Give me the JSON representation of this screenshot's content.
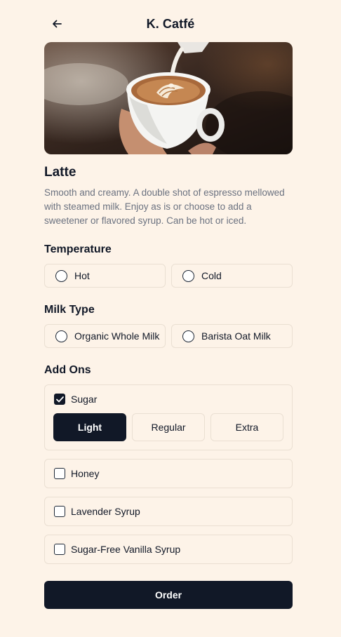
{
  "header": {
    "title": "K. Catfé",
    "back_icon": "arrow-left-icon"
  },
  "product": {
    "name": "Latte",
    "description": "Smooth and creamy. A double shot of espresso mellowed with steamed milk. Enjoy as is or choose to add a sweetener or flavored syrup. Can be hot or iced."
  },
  "temperature": {
    "title": "Temperature",
    "options": [
      "Hot",
      "Cold"
    ],
    "selected": null
  },
  "milk": {
    "title": "Milk Type",
    "options": [
      "Organic Whole Milk",
      "Barista Oat Milk"
    ],
    "selected": null
  },
  "addons": {
    "title": "Add Ons",
    "items": [
      {
        "label": "Sugar",
        "checked": true,
        "levels": [
          "Light",
          "Regular",
          "Extra"
        ],
        "selected_level": "Light"
      },
      {
        "label": "Honey",
        "checked": false
      },
      {
        "label": "Lavender Syrup",
        "checked": false
      },
      {
        "label": "Sugar-Free Vanilla Syrup",
        "checked": false
      }
    ]
  },
  "order": {
    "label": "Order"
  },
  "colors": {
    "background": "#fdf3e8",
    "primary": "#111827",
    "border": "#eadfd2",
    "muted_text": "#6b7280"
  }
}
